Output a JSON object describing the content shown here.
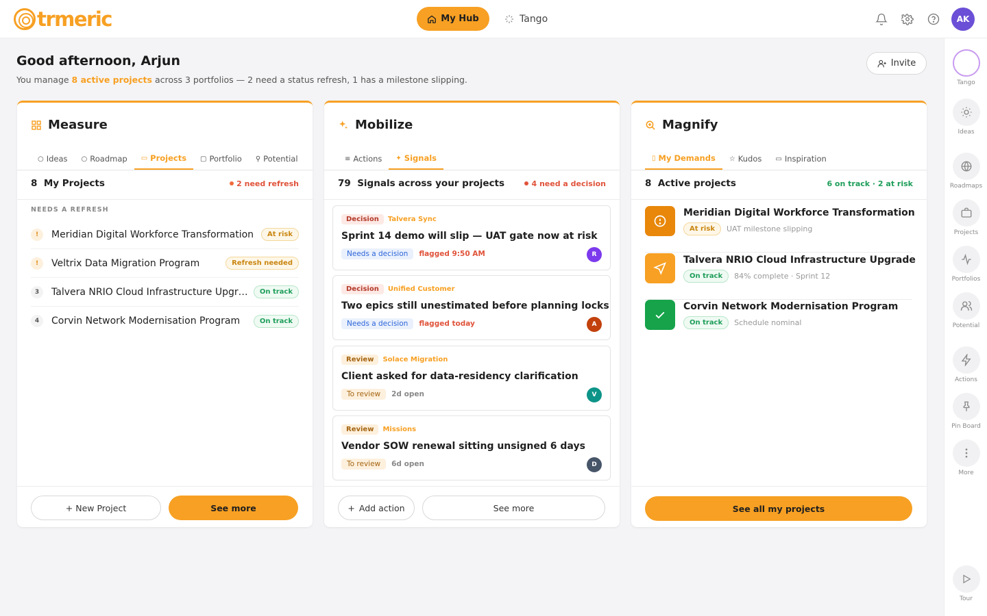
{
  "brand": {
    "name": "trmeric",
    "accent": "#f7a023"
  },
  "topbar": {
    "hub_label": "My Hub",
    "tango_label": "Tango",
    "avatar_initials": "AK"
  },
  "greeting": {
    "title": "Good afternoon, Arjun",
    "sub_prefix": "You manage ",
    "sub_highlight": "8 active projects",
    "sub_suffix": " across 3 portfolios — 2 need a status refresh, 1 has a milestone slipping.",
    "invite_label": "Invite"
  },
  "rail": {
    "items": [
      {
        "label": "Tango",
        "icon": "tango-ring-icon"
      },
      {
        "label": "Ideas",
        "icon": "sun-icon"
      },
      {
        "label": "Roadmaps",
        "icon": "globe-icon"
      },
      {
        "label": "Projects",
        "icon": "briefcase-icon"
      },
      {
        "label": "Portfolios",
        "icon": "pulse-icon"
      },
      {
        "label": "Potential",
        "icon": "users-icon"
      },
      {
        "label": "Actions",
        "icon": "lightning-icon"
      },
      {
        "label": "Pin Board",
        "icon": "pin-icon"
      },
      {
        "label": "More",
        "icon": "more-vertical-icon"
      },
      {
        "label": "Tour",
        "icon": "play-icon"
      }
    ]
  },
  "measure": {
    "title": "Measure",
    "tabs": [
      "Ideas",
      "Roadmap",
      "Projects",
      "Portfolio",
      "Potential"
    ],
    "active_tab": "Projects",
    "count": "8",
    "heading": "My Projects",
    "note": "2 need refresh",
    "needs_label": "NEEDS A REFRESH",
    "projects": [
      {
        "badge": "!",
        "name": "Meridian Digital Workforce Transformation",
        "status": "At risk"
      },
      {
        "badge": "!",
        "name": "Veltrix Data Migration Program",
        "status": "Refresh needed"
      },
      {
        "badge": "3",
        "name": "Talvera NRIO Cloud Infrastructure Upgrade",
        "status": "On track"
      },
      {
        "badge": "4",
        "name": "Corvin Network Modernisation Program",
        "status": "On track"
      }
    ],
    "new_project_label": "+ New Project",
    "see_more_label": "See more"
  },
  "mobilize": {
    "title": "Mobilize",
    "tabs": [
      "Actions",
      "Signals"
    ],
    "active_tab": "Signals",
    "count": "79",
    "heading": "Signals across your projects",
    "note": "4 need a decision",
    "signals": [
      {
        "type": "Decision",
        "source": "Talvera Sync",
        "title": "Sprint 14 demo will slip — UAT gate now at risk",
        "state": "Needs a decision",
        "time": "flagged 9:50 AM",
        "avatar": "R",
        "avatar_color": "#7c3aed"
      },
      {
        "type": "Decision",
        "source": "Unified Customer",
        "title": "Two epics still unestimated before planning locks",
        "state": "Needs a decision",
        "time": "flagged today",
        "avatar": "A",
        "avatar_color": "#c2410c"
      },
      {
        "type": "Review",
        "source": "Solace Migration",
        "title": "Client asked for data-residency clarification",
        "state": "To review",
        "time": "2d open",
        "avatar": "V",
        "avatar_color": "#0d9488"
      },
      {
        "type": "Review",
        "source": "Missions",
        "title": "Vendor SOW renewal sitting unsigned 6 days",
        "state": "To review",
        "time": "6d open",
        "avatar": "D",
        "avatar_color": "#475569"
      }
    ],
    "add_action_label": "Add action",
    "see_more_label": "See more"
  },
  "magnify": {
    "title": "Magnify",
    "tabs": [
      "My Demands",
      "Kudos",
      "Inspiration"
    ],
    "active_tab": "My Demands",
    "count": "8",
    "heading": "Active projects",
    "note": "6 on track · 2 at risk",
    "projects": [
      {
        "name": "Meridian Digital Workforce Transformation",
        "status": "At risk",
        "detail": "UAT milestone slipping",
        "icon": "alert-circle-icon",
        "color": "#e8870a"
      },
      {
        "name": "Talvera NRIO Cloud Infrastructure Upgrade",
        "status": "On track",
        "detail": "84% complete · Sprint 12",
        "icon": "send-icon",
        "color": "#f7a023"
      },
      {
        "name": "Corvin Network Modernisation Program",
        "status": "On track",
        "detail": "Schedule nominal",
        "icon": "check-icon",
        "color": "#16a34a"
      }
    ],
    "see_all_label": "See all my projects"
  }
}
